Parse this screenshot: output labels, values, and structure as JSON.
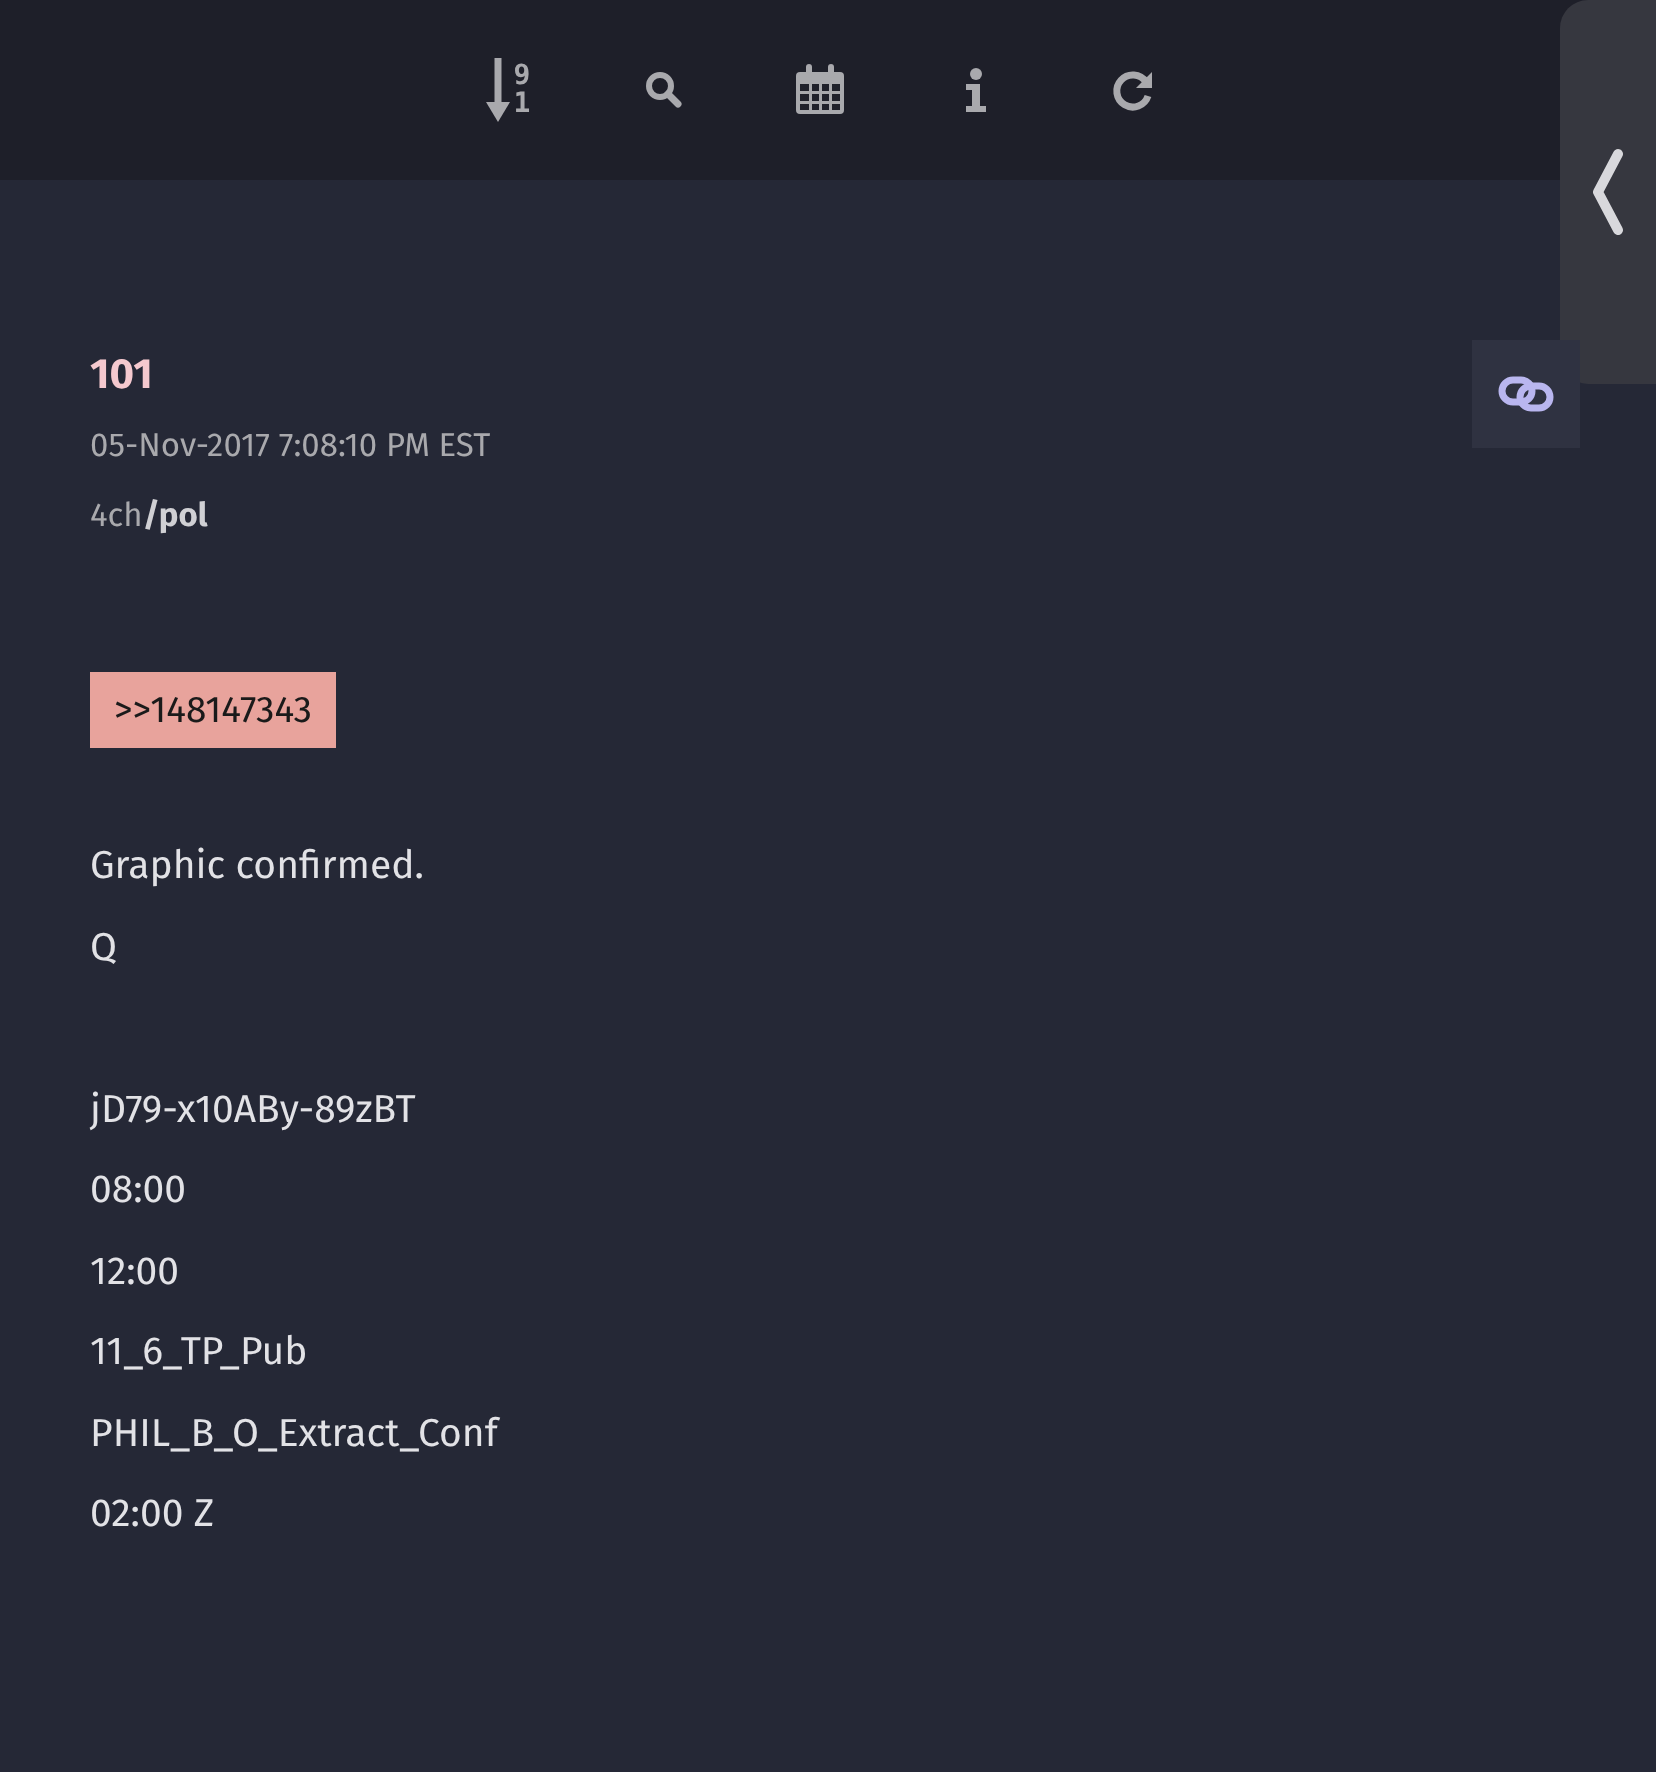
{
  "toolbar": {
    "sort_digits": [
      "9",
      "1"
    ],
    "buttons": [
      {
        "kind": "search"
      },
      {
        "kind": "calendar"
      },
      {
        "kind": "info"
      },
      {
        "kind": "refresh"
      }
    ]
  },
  "post": {
    "number": "101",
    "timestamp": "05-Nov-2017 7:08:10 PM EST",
    "source": "4ch",
    "board": "/pol",
    "reference": ">>148147343",
    "paragraphs": [
      [
        "Graphic confirmed.",
        "Q"
      ],
      [
        "jD79-x10ABy-89zBT",
        "08:00",
        "12:00",
        "11_6_TP_Pub",
        "PHIL_B_O_Extract_Conf",
        "02:00 Z"
      ]
    ]
  }
}
